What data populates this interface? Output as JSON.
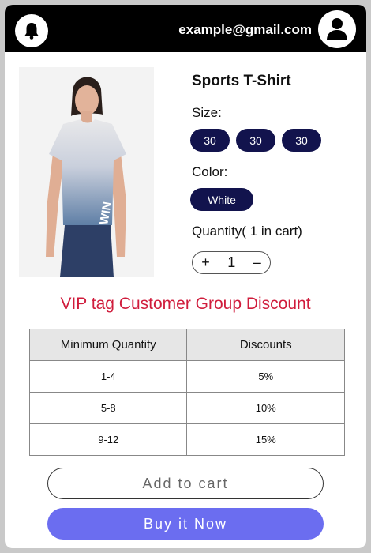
{
  "header": {
    "email": "example@gmail.com",
    "icons": {
      "notifications": "bell-icon",
      "account": "user-icon"
    }
  },
  "product": {
    "title": "Sports T-Shirt",
    "size_label": "Size:",
    "sizes": [
      "30",
      "30",
      "30"
    ],
    "color_label": "Color:",
    "colors": [
      "White"
    ],
    "quantity_label": "Quantity( 1 in cart)",
    "quantity": "1",
    "increment": "+",
    "decrement": "–",
    "image_print_text": "WIN"
  },
  "discount": {
    "title": "VIP tag Customer Group Discount",
    "headers": [
      "Minimum Quantity",
      "Discounts"
    ],
    "rows": [
      [
        "1-4",
        "5%"
      ],
      [
        "5-8",
        "10%"
      ],
      [
        "9-12",
        "15%"
      ]
    ]
  },
  "actions": {
    "add_to_cart": "Add to cart",
    "buy_now": "Buy it Now"
  },
  "colors": {
    "header_bg": "#000000",
    "chip_bg": "#12134d",
    "discount_title": "#d01c3c",
    "buy_button": "#6b6df0"
  }
}
